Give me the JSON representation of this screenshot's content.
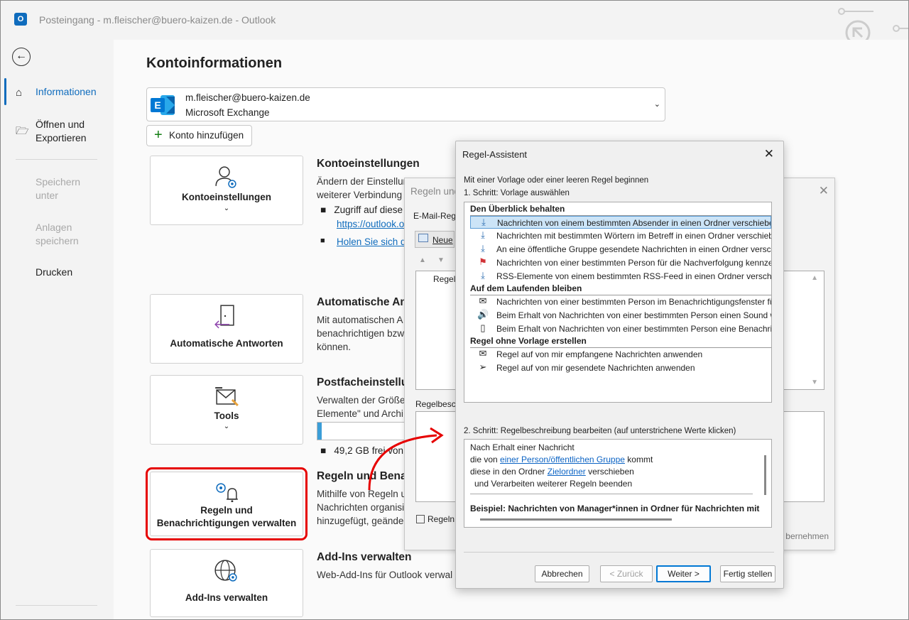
{
  "window": {
    "title": "Posteingang - m.fleischer@buero-kaizen.de - Outlook",
    "app_icon": "O"
  },
  "nav": {
    "items": [
      {
        "label": "Informationen",
        "icon": "home-icon"
      },
      {
        "label": "Öffnen und\nExportieren",
        "icon": "folder-open-icon"
      },
      {
        "label": "Speichern\nunter"
      },
      {
        "label": "Anlagen\nspeichern"
      },
      {
        "label": "Drucken"
      }
    ]
  },
  "main": {
    "heading": "Kontoinformationen",
    "account": {
      "email": "m.fleischer@buero-kaizen.de",
      "type": "Microsoft Exchange",
      "logo_letter": "E"
    },
    "add_account": "Konto hinzufügen",
    "cards": [
      {
        "label": "Kontoeinstellungen",
        "chevron": "⌄"
      },
      {
        "label": "Automatische Antworten"
      },
      {
        "label": "Tools",
        "chevron": "⌄"
      },
      {
        "label": "Regeln und\nBenachrichtigungen verwalten"
      },
      {
        "label": "Add-Ins verwalten"
      }
    ],
    "sections": {
      "konto": {
        "title": "Kontoeinstellungen",
        "line1": "Ändern der Einstellun",
        "line2": "weiterer Verbindung",
        "bullet1": "Zugriff auf diese",
        "link1": "https://outlook.o",
        "link2": "Holen Sie sich d"
      },
      "auto": {
        "title": "Automatische An",
        "line1": "Mit automatischen A",
        "line2": "benachrichtigen bzw",
        "line3": "können."
      },
      "postfach": {
        "title": "Postfacheinstellu",
        "line1": "Verwalten der Größe",
        "line2": "Elemente\" und Archi",
        "free": "49,2 GB frei von",
        "used_fraction": 0.04
      },
      "regeln": {
        "title": "Regeln und Bena",
        "line1": "Mithilfe von Regeln u",
        "line2": "Nachrichten organisi",
        "line3": "hinzugefügt, geände"
      },
      "addins": {
        "title": "Add-Ins verwalten",
        "line1": "Web-Add-Ins für Outlook verwal"
      }
    }
  },
  "rules_dialog": {
    "title": "Regeln und",
    "tab": "E-Mail-Reg",
    "new_button": "Neue",
    "col": "Regel",
    "desc_label": "Regelbesch",
    "checkbox": "Regeln",
    "apply": "bernehmen"
  },
  "wizard": {
    "title": "Regel-Assistent",
    "intro": "Mit einer Vorlage oder einer leeren Regel beginnen",
    "step1": "1. Schritt: Vorlage auswählen",
    "groups": [
      {
        "header": "Den Überblick behalten",
        "items": [
          {
            "icon": "move-to-folder-icon",
            "text": "Nachrichten von einem bestimmten Absender in einen Ordner verschiebe",
            "selected": true
          },
          {
            "icon": "move-to-folder-icon",
            "text": "Nachrichten mit bestimmten Wörtern im Betreff in einen Ordner verschieb"
          },
          {
            "icon": "move-to-folder-icon",
            "text": "An eine öffentliche Gruppe gesendete Nachrichten in einen Ordner versch"
          },
          {
            "icon": "red-flag-icon",
            "text": "Nachrichten von einer bestimmten Person für die Nachverfolgung kennze"
          },
          {
            "icon": "rss-folder-icon",
            "text": "RSS-Elemente von einem bestimmten RSS-Feed in einen Ordner verschieb"
          }
        ]
      },
      {
        "header": "Auf dem Laufenden bleiben",
        "items": [
          {
            "icon": "alert-window-icon",
            "text": "Nachrichten von einer bestimmten Person im Benachrichtigungsfenster für"
          },
          {
            "icon": "speaker-icon",
            "text": "Beim Erhalt von Nachrichten von einer bestimmten Person einen Sound w"
          },
          {
            "icon": "mobile-phone-icon",
            "text": "Beim Erhalt von Nachrichten von einer bestimmten Person eine Benachrich"
          }
        ]
      },
      {
        "header": "Regel ohne Vorlage erstellen",
        "items": [
          {
            "icon": "envelope-icon",
            "text": "Regel auf von mir empfangene Nachrichten anwenden"
          },
          {
            "icon": "send-icon",
            "text": "Regel auf von mir gesendete Nachrichten anwenden"
          }
        ]
      }
    ],
    "step2": "2. Schritt: Regelbeschreibung bearbeiten (auf unterstrichene Werte klicken)",
    "desc": {
      "l1": "Nach Erhalt einer Nachricht",
      "l2_pre": "die von ",
      "l2_link": "einer Person/öffentlichen Gruppe",
      "l2_post": " kommt",
      "l3_pre": "diese in den Ordner ",
      "l3_link": "Zielordner",
      "l3_post": " verschieben",
      "l4": "und Verarbeiten weiterer Regeln beenden",
      "example": "Beispiel: Nachrichten von Manager*innen in Ordner für Nachrichten mit"
    },
    "buttons": {
      "cancel": "Abbrechen",
      "back": "< Zurück",
      "next": "Weiter >",
      "finish": "Fertig stellen"
    }
  },
  "colors": {
    "accent": "#0f6cbd",
    "highlight": "#e60000",
    "arrow": "#e60000"
  }
}
